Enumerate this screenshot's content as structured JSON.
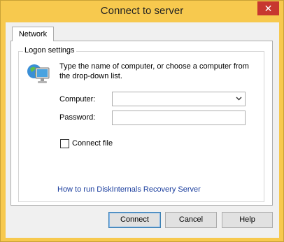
{
  "window": {
    "title": "Connect to server",
    "close_label": "✕"
  },
  "tabs": [
    {
      "label": "Network"
    }
  ],
  "logon": {
    "group_title": "Logon settings",
    "description": "Type the name of computer, or choose a computer  from the drop-down list.",
    "computer_label": "Computer:",
    "computer_value": "",
    "password_label": "Password:",
    "password_value": "",
    "connect_file_label": "Connect file",
    "connect_file_checked": false,
    "help_link": "How to run DiskInternals Recovery Server"
  },
  "buttons": {
    "connect": "Connect",
    "cancel": "Cancel",
    "help": "Help"
  },
  "colors": {
    "frame": "#f7c94e",
    "close": "#c7372f",
    "link": "#1b3e9e"
  },
  "icons": {
    "computer": "network-computer-icon",
    "dropdown": "chevron-down-icon"
  }
}
